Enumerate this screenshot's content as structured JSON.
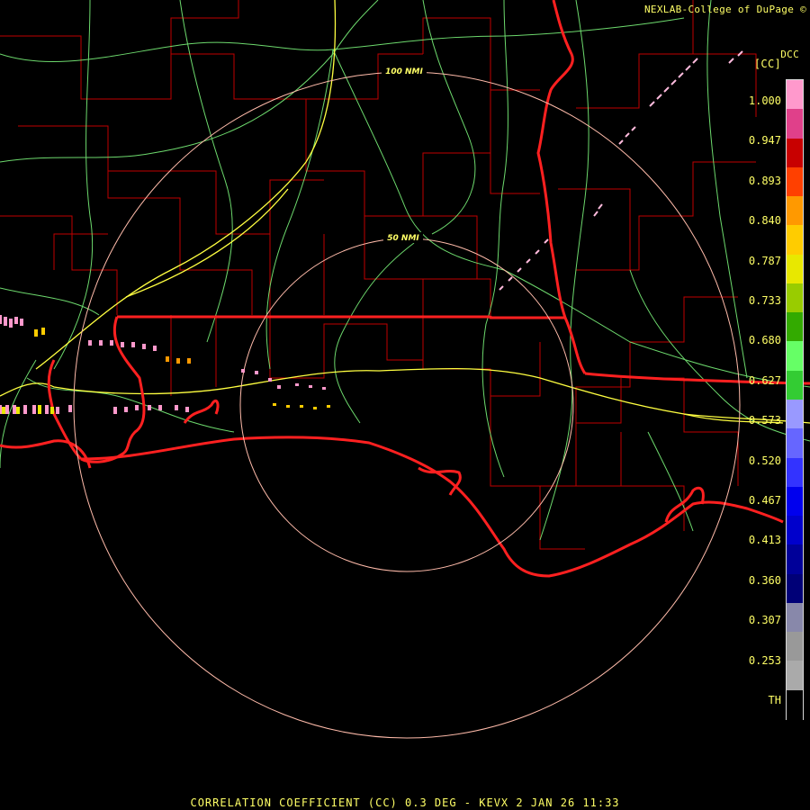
{
  "header": {
    "credit": "NEXLAB-College of DuPage ©",
    "station": "DCC",
    "product": "[CC]"
  },
  "footer": {
    "title": "CORRELATION COEFFICIENT (CC) 0.3 DEG - KEVX 2 JAN 26 11:33"
  },
  "range_rings": [
    {
      "label": "50 NMI"
    },
    {
      "label": "100 NMI"
    }
  ],
  "legend": {
    "ticks": [
      "1.000",
      "0.947",
      "0.893",
      "0.840",
      "0.787",
      "0.733",
      "0.680",
      "0.627",
      "0.573",
      "0.520",
      "0.467",
      "0.413",
      "0.360",
      "0.307",
      "0.253",
      "TH"
    ],
    "colors": [
      "#ff99cc",
      "#e0408a",
      "#c80000",
      "#ff4000",
      "#ff9900",
      "#ffcc00",
      "#e8e800",
      "#99cc00",
      "#33aa00",
      "#66ff66",
      "#33cc33",
      "#9999ff",
      "#6666ff",
      "#3333ff",
      "#0000ee",
      "#0000cc",
      "#000099",
      "#000077",
      "#8888aa",
      "#999999",
      "#aaaaaa",
      "#000000"
    ]
  },
  "colors": {
    "state_border": "#ff2020",
    "county_line": "#c00000",
    "highway": "#80ff80",
    "interstate": "#ffff40",
    "range_ring": "#ffbbaa",
    "text": "#ffff66"
  }
}
